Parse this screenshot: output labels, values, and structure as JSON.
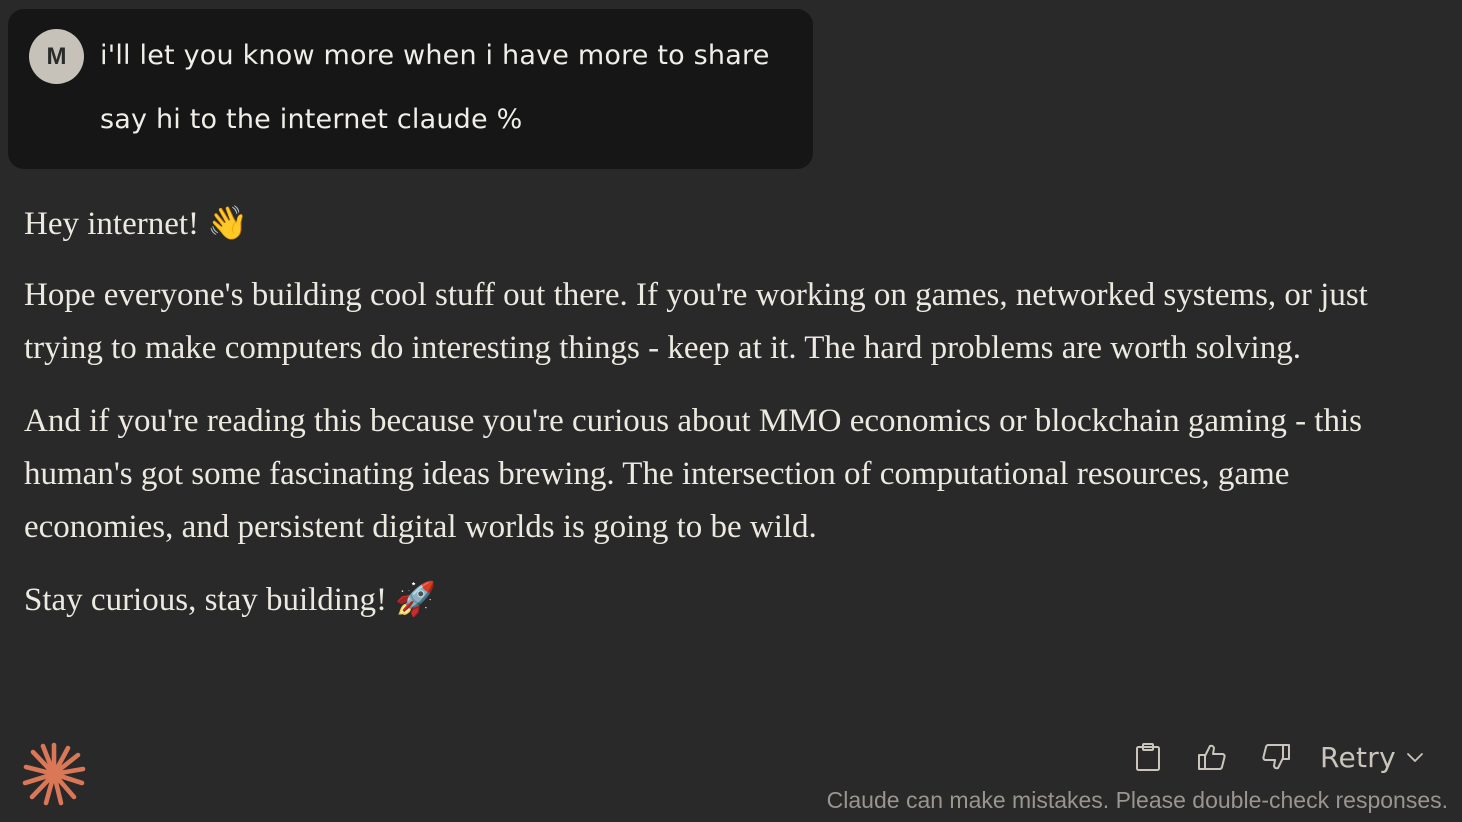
{
  "user_message": {
    "avatar_initial": "M",
    "lines": [
      "i'll let you know more when i have more to share",
      "say hi to the internet claude %"
    ]
  },
  "assistant_message": {
    "paragraphs": [
      "Hey internet! 👋",
      "Hope everyone's building cool stuff out there. If you're working on games, networked systems, or just trying to make computers do interesting things - keep at it. The hard problems are worth solving.",
      "And if you're reading this because you're curious about MMO economics or blockchain gaming - this human's got some fascinating ideas brewing. The intersection of computational resources, game economies, and persistent digital worlds is going to be wild.",
      "Stay curious, stay building! 🚀"
    ]
  },
  "actions": {
    "copy_icon": "clipboard-icon",
    "thumbs_up_icon": "thumbs-up-icon",
    "thumbs_down_icon": "thumbs-down-icon",
    "retry_label": "Retry",
    "retry_chevron_icon": "chevron-down-icon"
  },
  "footer": {
    "disclaimer": "Claude can make mistakes. Please double-check responses."
  },
  "colors": {
    "background": "#292929",
    "user_bubble": "#161616",
    "avatar_bg": "#c6c2b9",
    "claude_accent": "#d97757",
    "text": "#ece9e1",
    "muted_text": "#9a968f"
  }
}
